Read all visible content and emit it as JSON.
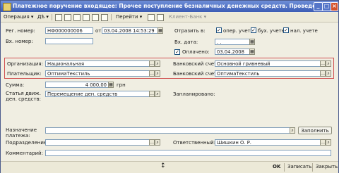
{
  "window": {
    "title": "Платежное поручение входящее: Прочее поступление безналичных денежных средств. Проведен"
  },
  "toolbar": {
    "operation": "Операция ▾",
    "actions": "Дѣ ▾",
    "goto": "Перейти ▾",
    "client_bank": "Клиент-Банк ▾"
  },
  "form": {
    "reg_number_label": "Рег. номер:",
    "reg_number": "НФ000000006",
    "from_label": "от:",
    "reg_date": "03.04.2008 14:53:29",
    "reflect_label": "Отразить в:",
    "opt_oper": "опер. учете",
    "opt_buh": "бух. учете",
    "opt_nal": "нал. учете",
    "in_number_label": "Вх. номер:",
    "in_number": "",
    "in_date_label": "Вх. дата:",
    "in_date": " .  .",
    "paid_label": "Оплачено:",
    "paid_date": "03.04.2008",
    "org_label": "Организация:",
    "org": "Национальная",
    "bank_acc_label": "Банковский счет:",
    "bank_acc": "Основной гривневый",
    "payer_label": "Плательщик:",
    "payer": "ОптимаТекстиль",
    "bank_acc2_label": "Банковский счет:",
    "bank_acc2": "ОптимаТекстиль",
    "sum_label": "Сумма:",
    "sum": "4 000,00",
    "currency": "грн",
    "cashflow_label_1": "Статья движ.",
    "cashflow_label_2": "ден. средств:",
    "cashflow": "Перемещение ден. средств",
    "planned_label": "Запланировано:",
    "purpose_label_1": "Назначение",
    "purpose_label_2": "платежа:",
    "purpose": "",
    "fill_button": "Заполнить",
    "department_label": "Подразделение:",
    "department": "",
    "responsible_label": "Ответственный:",
    "responsible": "Шишкин О. Р.",
    "comment_label": "Комментарий:",
    "comment": ""
  },
  "bottom": {
    "ok": "OK",
    "save": "Записать",
    "close": "Закрыть"
  }
}
